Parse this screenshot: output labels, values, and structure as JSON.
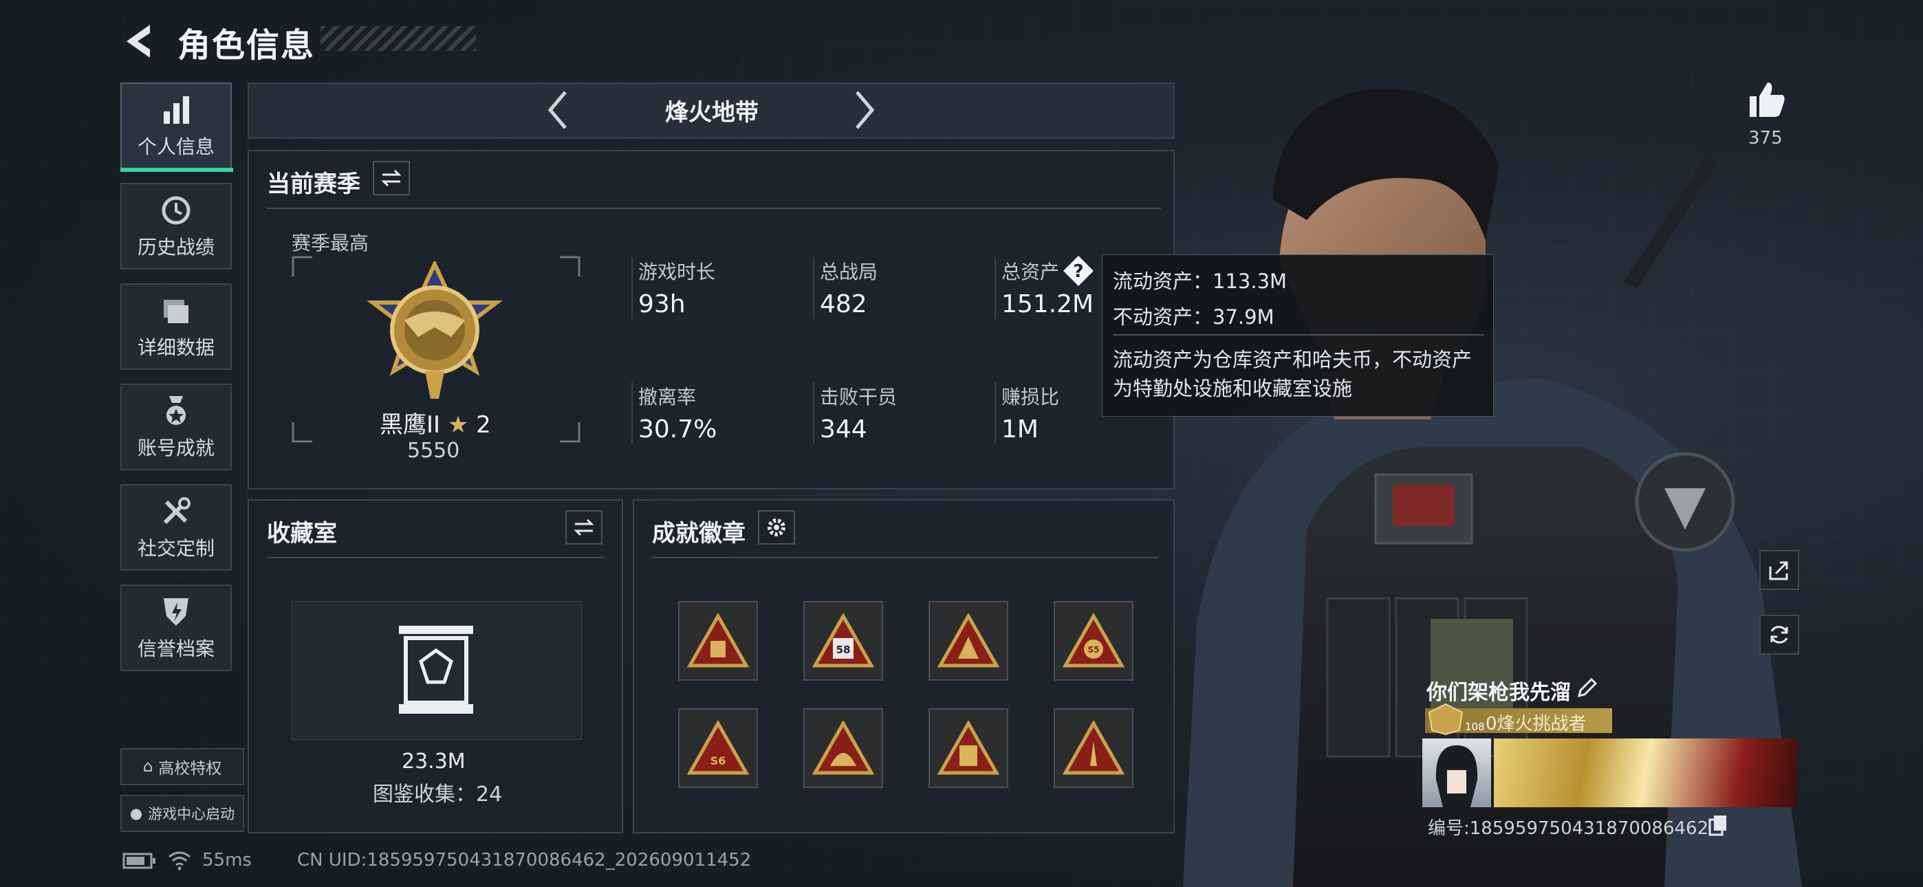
{
  "header": {
    "title": "角色信息"
  },
  "nav": [
    {
      "label": "个人信息",
      "icon": "bar-chart-icon",
      "active": true
    },
    {
      "label": "历史战绩",
      "icon": "history-clock-icon"
    },
    {
      "label": "详细数据",
      "icon": "folder-icon"
    },
    {
      "label": "账号成就",
      "icon": "achievement-medal-icon"
    },
    {
      "label": "社交定制",
      "icon": "tools-icon"
    },
    {
      "label": "信誉档案",
      "icon": "shield-bolt-icon"
    }
  ],
  "extras": {
    "campus": "高校特权",
    "game_center": "游戏中心启动"
  },
  "season_selector": {
    "name": "烽火地带"
  },
  "current_season": {
    "title": "当前赛季",
    "highest_label": "赛季最高",
    "rank_name": "黑鹰II",
    "rank_stars": "2",
    "rank_score": "5550",
    "stats": [
      {
        "label": "游戏时长",
        "value": "93h"
      },
      {
        "label": "总战局",
        "value": "482"
      },
      {
        "label": "总资产",
        "value": "151.2M"
      },
      {
        "label": "撤离率",
        "value": "30.7%"
      },
      {
        "label": "击败干员",
        "value": "344"
      },
      {
        "label": "赚损比",
        "value": "1M"
      }
    ]
  },
  "tooltip": {
    "liquid": "流动资产：113.3M",
    "fixed": "不动资产：37.9M",
    "desc_line1": "流动资产为仓库资产和哈夫币，不动资产",
    "desc_line2": "为特勤处设施和收藏室设施"
  },
  "collection": {
    "title": "收藏室",
    "value": "23.3M",
    "count": "图鉴收集：24"
  },
  "badges": {
    "title": "成就徽章",
    "items": [
      "badge-1",
      "badge-2",
      "badge-3",
      "badge-4",
      "badge-5",
      "badge-6",
      "badge-7",
      "badge-8"
    ],
    "badge2_text": "58",
    "badge4_text": "S5",
    "badge5_text": "S6"
  },
  "likes": {
    "count": "375"
  },
  "player": {
    "name": "你们架枪我先溜",
    "title": "0烽火挑战者",
    "level": "108",
    "id": "编号:18595975043187008646​2"
  },
  "status": {
    "ping": "55ms",
    "uid": "CN UID:18595975043187008646​2_202609011452"
  },
  "colors": {
    "accent": "#3bd39a",
    "gold": "#c9a24a",
    "badge_red": "#8a1f1a"
  }
}
